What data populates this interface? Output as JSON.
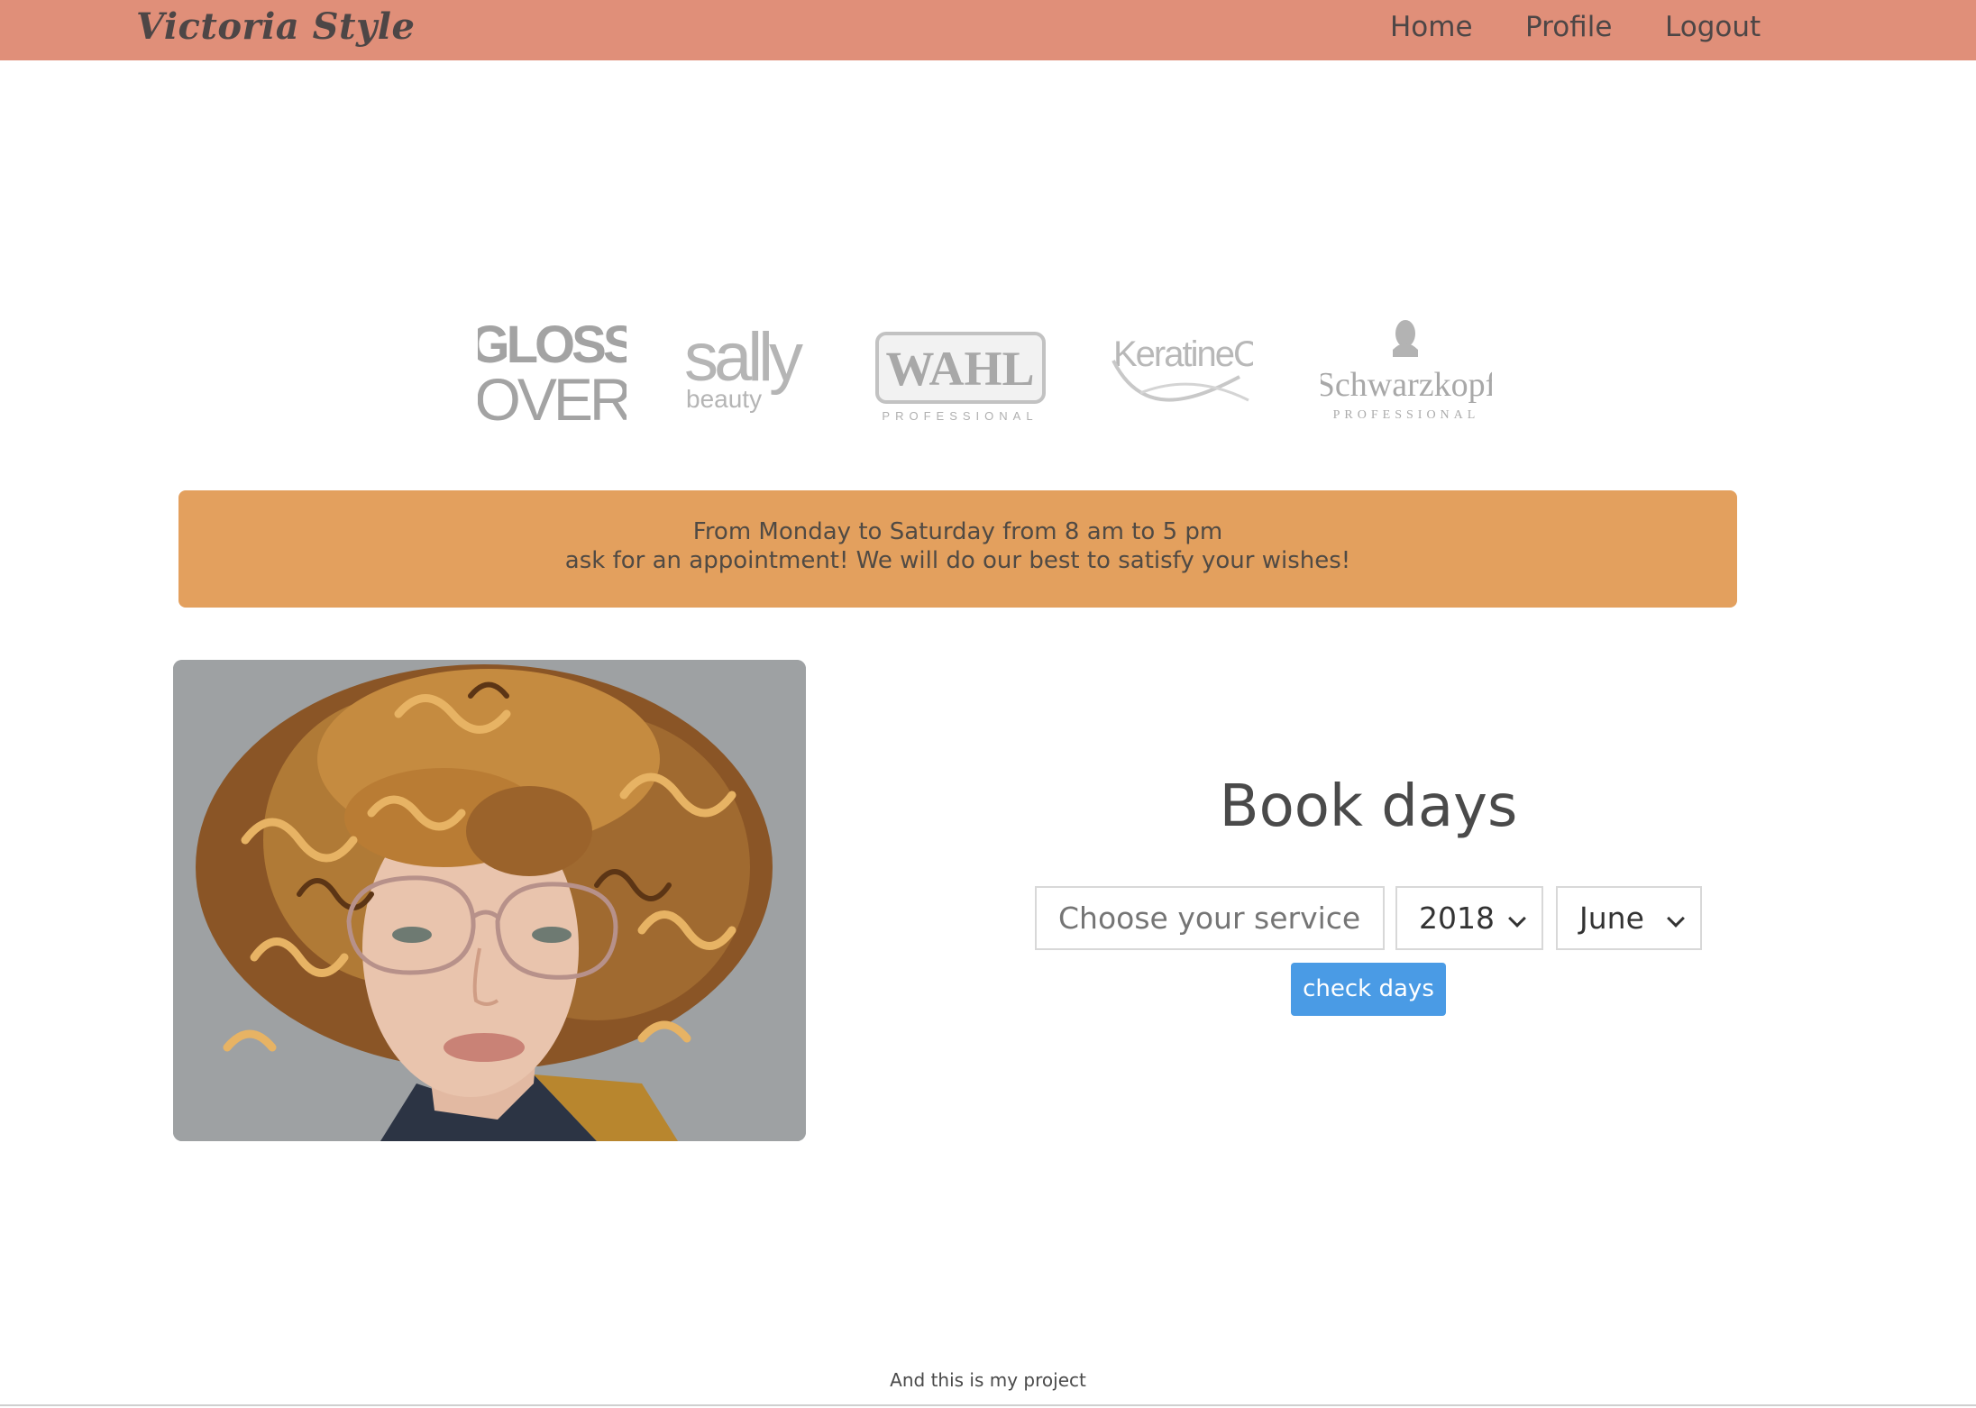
{
  "navbar": {
    "brand": "Victoria Style",
    "links": [
      {
        "label": "Home"
      },
      {
        "label": "Profile"
      },
      {
        "label": "Logout"
      }
    ],
    "color": "#e08f79"
  },
  "brand_logos": [
    {
      "name": "gloss-over-logo",
      "text": "GLOSS OVER"
    },
    {
      "name": "sally-beauty-logo",
      "text": "sally beauty"
    },
    {
      "name": "wahl-logo",
      "text": "WAHL PROFESSIONAL"
    },
    {
      "name": "keratineco-logo",
      "text": "KeratineCo"
    },
    {
      "name": "schwarzkopf-logo",
      "text": "Schwarzkopf PROFESSIONAL"
    }
  ],
  "banner": {
    "line1": "From Monday to Saturday from 8 am to 5 pm",
    "line2": "ask for an appointment! We will do our best to satisfy your wishes!",
    "color": "#e3a05e"
  },
  "booking": {
    "title": "Book days",
    "service_placeholder": "Choose your service",
    "year_value": "2018",
    "month_value": "June",
    "button_label": "check days",
    "button_color": "#4a9be5"
  },
  "footer": {
    "text": "And this is my project"
  }
}
